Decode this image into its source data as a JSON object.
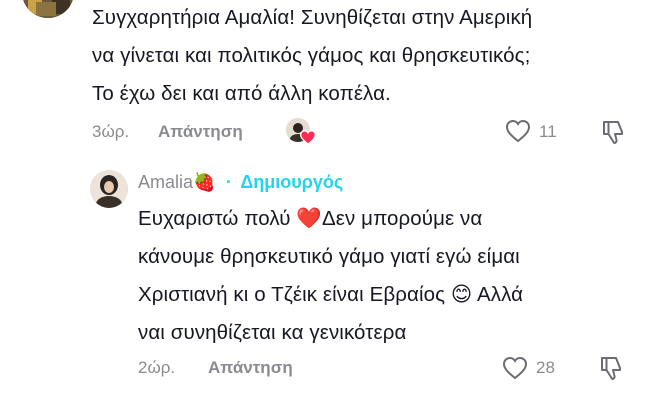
{
  "comments": [
    {
      "text_lines": [
        "Συγχαρητήρια Αμαλία! Συνηθίζεται στην Αμερική",
        "να γίνεται και πολιτικός γάμος και θρησκευτικός;",
        "Το έχω δει και από άλλη κοπέλα."
      ],
      "time": "3ώρ.",
      "reply_label": "Απάντηση",
      "likes": "11"
    }
  ],
  "reply": {
    "author": "Amalia🍓",
    "separator": "·",
    "creator_label": "Δημιουργός",
    "text_lines": [
      "Ευχαριστώ πολύ ❤️Δεν μπορούμε να",
      "κάνουμε θρησκευτικό γάμο γιατί εγώ είμαι",
      "Χριστιανή κι ο Τζέικ είναι Εβραίος 😊 Αλλά",
      "ναι συνηθίζεται κα γενικότερα"
    ],
    "time": "2ώρ.",
    "reply_label": "Απάντηση",
    "likes": "28"
  },
  "colors": {
    "text": "#161823",
    "muted": "#8a8b91",
    "creator": "#20d5ec",
    "heart_badge": "#fe2c55"
  },
  "icons": [
    "heart-outline-icon",
    "thumbs-down-icon",
    "liked-by-creator-heart-icon"
  ]
}
